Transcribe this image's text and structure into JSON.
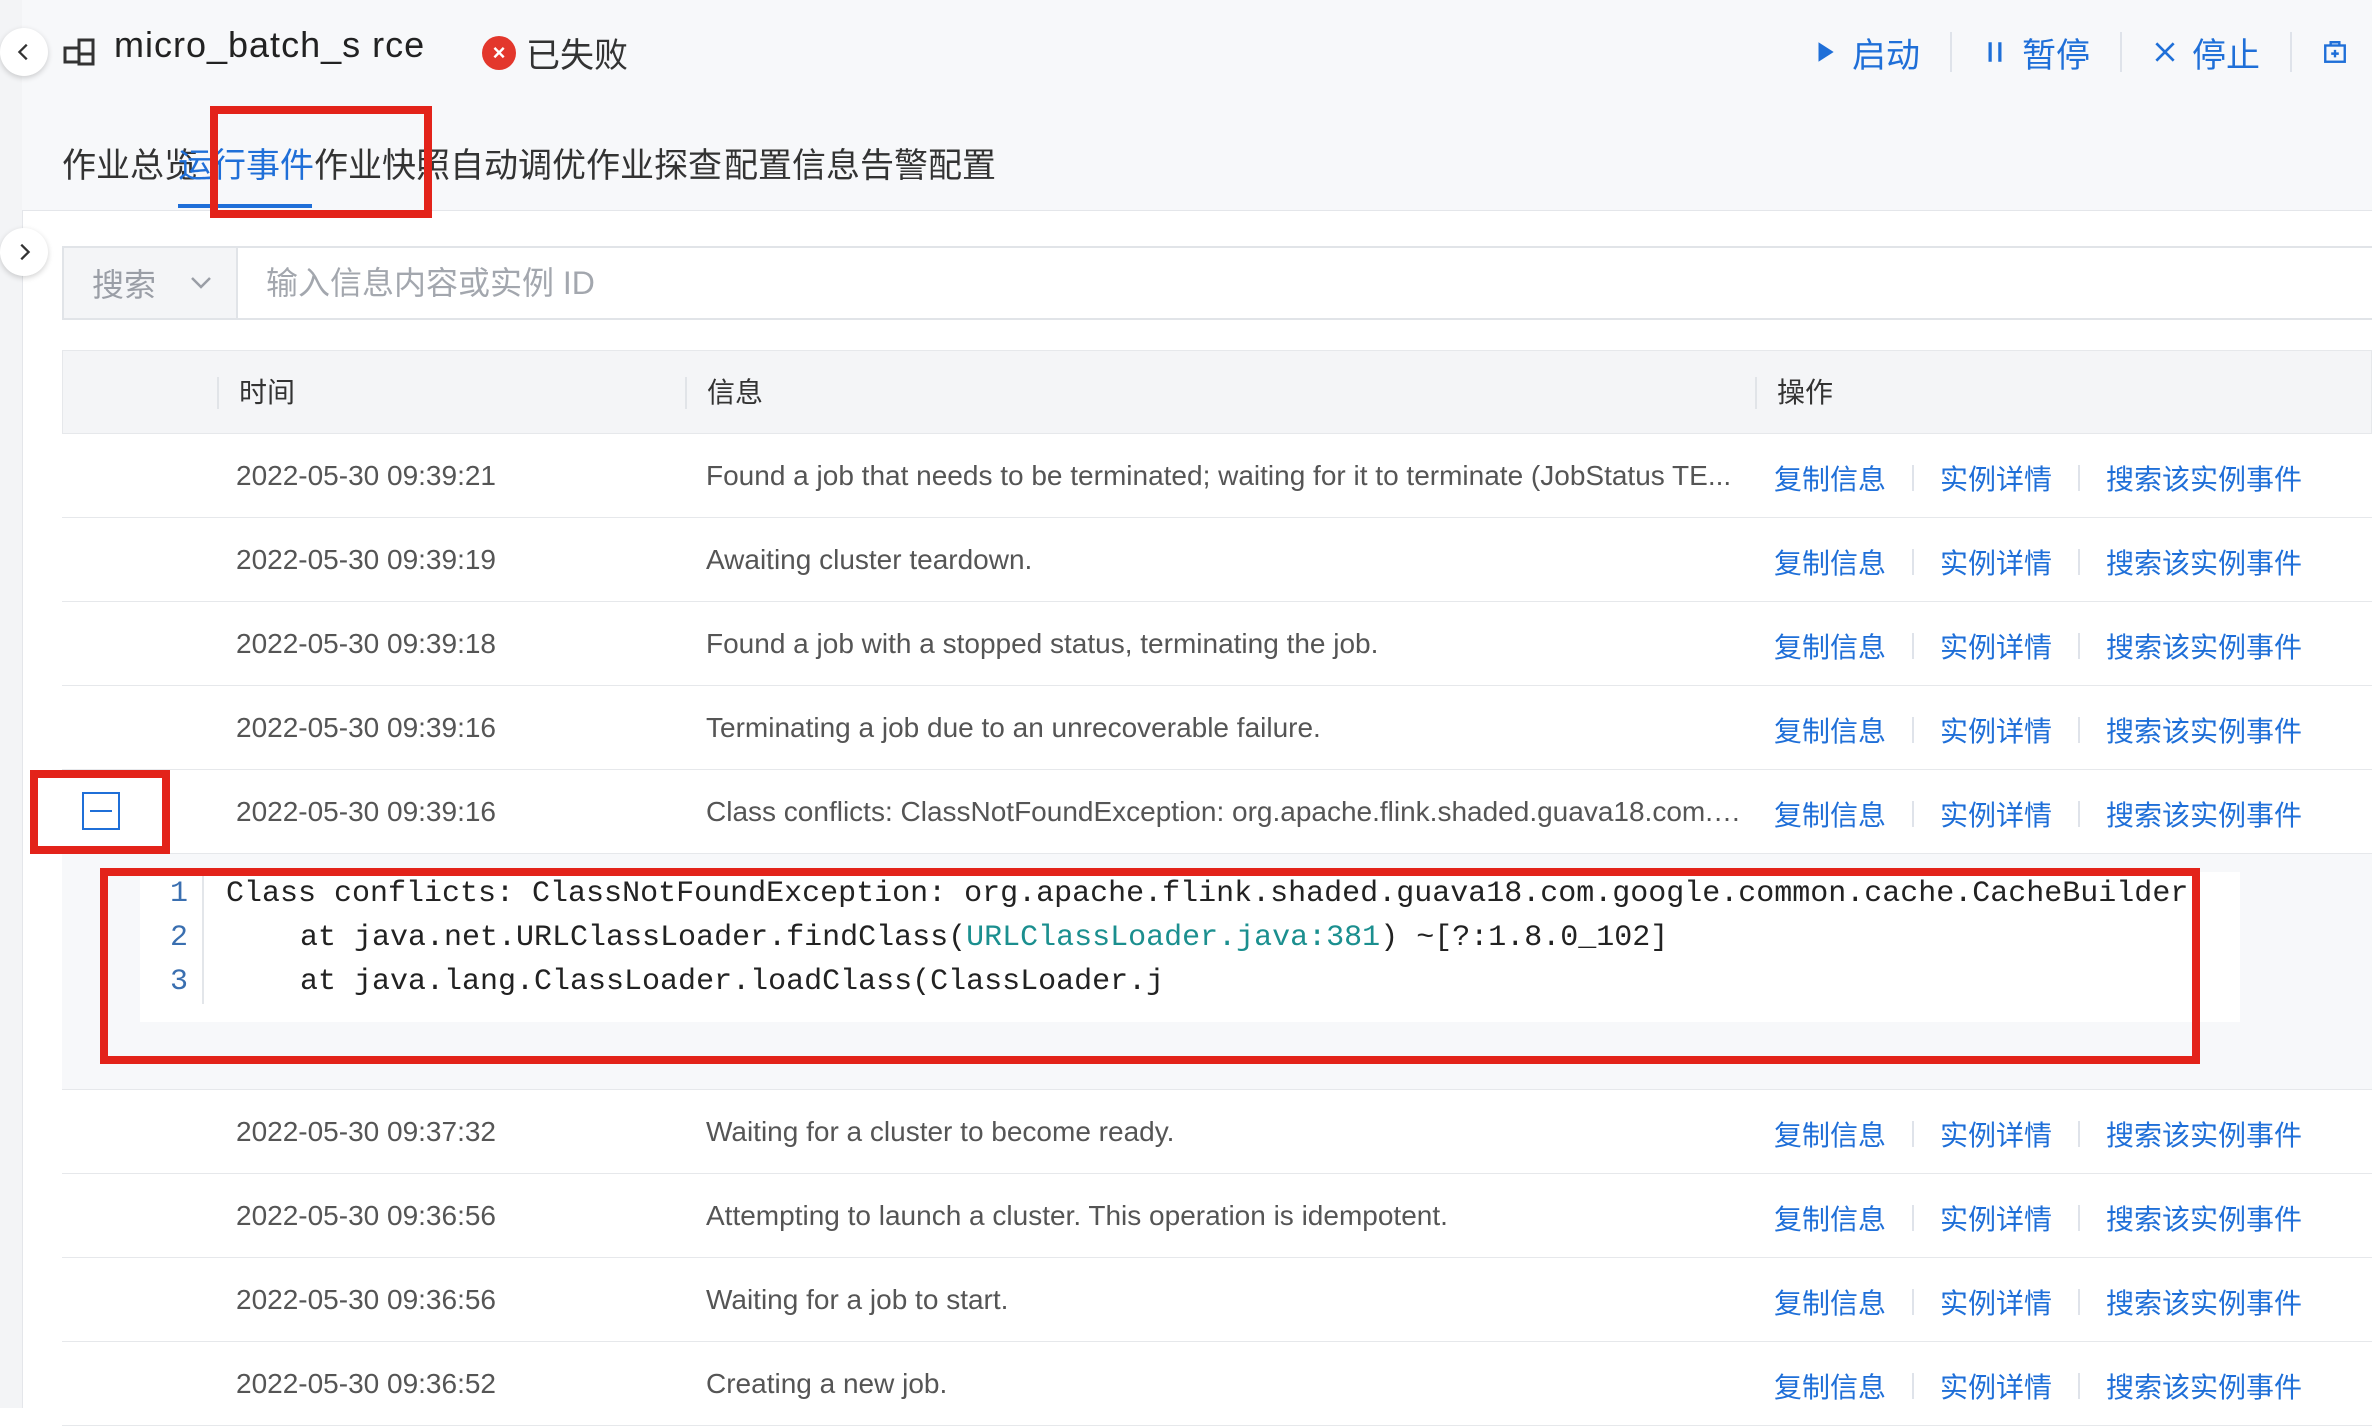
{
  "header": {
    "job_name": "micro_batch_s  rce",
    "status": "已失败",
    "actions": [
      {
        "label": "启动",
        "icon": "play-icon"
      },
      {
        "label": "暂停",
        "icon": "pause-icon"
      },
      {
        "label": "停止",
        "icon": "stop-icon"
      },
      {
        "label": "",
        "icon": "export-icon"
      }
    ]
  },
  "tabs": [
    {
      "label": "作业总览"
    },
    {
      "label": "运行事件",
      "active": true
    },
    {
      "label": "作业快照"
    },
    {
      "label": "自动调优"
    },
    {
      "label": "作业探查"
    },
    {
      "label": "配置信息"
    },
    {
      "label": "告警配置"
    }
  ],
  "search": {
    "type_label": "搜索",
    "placeholder": "输入信息内容或实例 ID"
  },
  "table": {
    "columns": [
      "时间",
      "信息",
      "操作"
    ],
    "op_labels": [
      "复制信息",
      "实例详情",
      "搜索该实例事件"
    ],
    "rows": [
      {
        "time": "2022-05-30 09:39:21",
        "info": "Found a job that needs to be terminated; waiting for it to terminate (JobStatus TE..."
      },
      {
        "time": "2022-05-30 09:39:19",
        "info": "Awaiting cluster teardown."
      },
      {
        "time": "2022-05-30 09:39:18",
        "info": "Found a job with a stopped status, terminating the job."
      },
      {
        "time": "2022-05-30 09:39:16",
        "info": "Terminating a job due to an unrecoverable failure."
      },
      {
        "time": "2022-05-30 09:39:16",
        "info": "Class conflicts: ClassNotFoundException: org.apache.flink.shaded.guava18.com.g..."
      },
      {
        "time": "2022-05-30 09:37:32",
        "info": "Waiting for a cluster to become ready."
      },
      {
        "time": "2022-05-30 09:36:56",
        "info": "Attempting to launch a cluster. This operation is idempotent."
      },
      {
        "time": "2022-05-30 09:36:56",
        "info": "Waiting for a job to start."
      },
      {
        "time": "2022-05-30 09:36:52",
        "info": "Creating a new job."
      }
    ]
  },
  "expanded_detail": {
    "lines": [
      {
        "num": "1",
        "text": "Class conflicts: ClassNotFoundException: org.apache.flink.shaded.guava18.com.google.common.cache.CacheBuilder"
      },
      {
        "num": "2",
        "prefix": "at java.net.URLClassLoader.findClass(",
        "ref": "URLClassLoader.java:381",
        "suffix": ") ~[?:1.8.0_102]"
      },
      {
        "num": "3",
        "text": "at java.lang.ClassLoader.loadClass(ClassLoader.j"
      }
    ]
  },
  "colors": {
    "accent": "#1f6fd8",
    "error": "#e3372c",
    "highlight_box": "#e3231a"
  }
}
